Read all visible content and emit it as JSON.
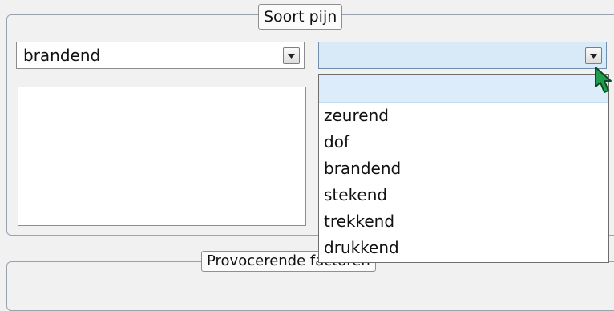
{
  "soort_pijn": {
    "legend": "Soort pijn",
    "left_select": {
      "value": "brandend",
      "icon": "chevron-down-icon"
    },
    "right_select": {
      "value": "",
      "icon": "chevron-down-icon"
    },
    "dropdown_options": [
      "",
      "zeurend",
      "dof",
      "brandend",
      "stekend",
      "trekkend",
      "drukkend"
    ]
  },
  "provocerende": {
    "legend": "Provocerende factoren"
  },
  "colors": {
    "selected_field": "#d8eaf8",
    "highlight": "#dcecfb",
    "cursor": "#1e9e4a"
  },
  "cursor_icon": "green-arrow-cursor-icon"
}
